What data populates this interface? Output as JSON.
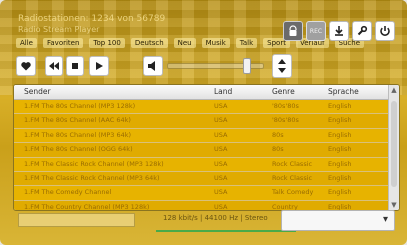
{
  "window": {
    "title": "Radiostationen: 1234 von 56789",
    "subtitle": "Radio Stream Player",
    "buttons": {
      "rec_label": "REC"
    }
  },
  "tabs": [
    "Alle",
    "Favoriten",
    "Top 100",
    "Deutsch",
    "Neu",
    "Musik",
    "Talk",
    "Sport",
    "Verlauf",
    "Suche"
  ],
  "toolbar": {
    "speaker_icon": "speaker-icon",
    "volume_level": 0.82
  },
  "table": {
    "columns": [
      "Sender",
      "Land",
      "Genre",
      "Sprache"
    ],
    "rows": [
      {
        "sender": "1.FM The 80s Channel (MP3 128k)",
        "land": "USA",
        "genre": "'80s'80s",
        "sprache": "English"
      },
      {
        "sender": "1.FM The 80s Channel (AAC 64k)",
        "land": "USA",
        "genre": "'80s'80s",
        "sprache": "English"
      },
      {
        "sender": "1.FM The 80s Channel (MP3 64k)",
        "land": "USA",
        "genre": "80s",
        "sprache": "English"
      },
      {
        "sender": "1.FM The 80s Channel (OGG 64k)",
        "land": "USA",
        "genre": "80s",
        "sprache": "English"
      },
      {
        "sender": "1.FM The Classic Rock Channel (MP3 128k)",
        "land": "USA",
        "genre": "Rock Classic",
        "sprache": "English"
      },
      {
        "sender": "1.FM The Classic Rock Channel (MP3 64k)",
        "land": "USA",
        "genre": "Rock Classic",
        "sprache": "English"
      },
      {
        "sender": "1.FM The Comedy Channel",
        "land": "USA",
        "genre": "Talk Comedy",
        "sprache": "English"
      },
      {
        "sender": "1.FM The Country Channel (MP3 128k)",
        "land": "USA",
        "genre": "Country",
        "sprache": "English"
      }
    ]
  },
  "status": {
    "left_text": "",
    "center_text": "128 kbit/s  |  44100 Hz  |  Stereo",
    "select_value": ""
  }
}
